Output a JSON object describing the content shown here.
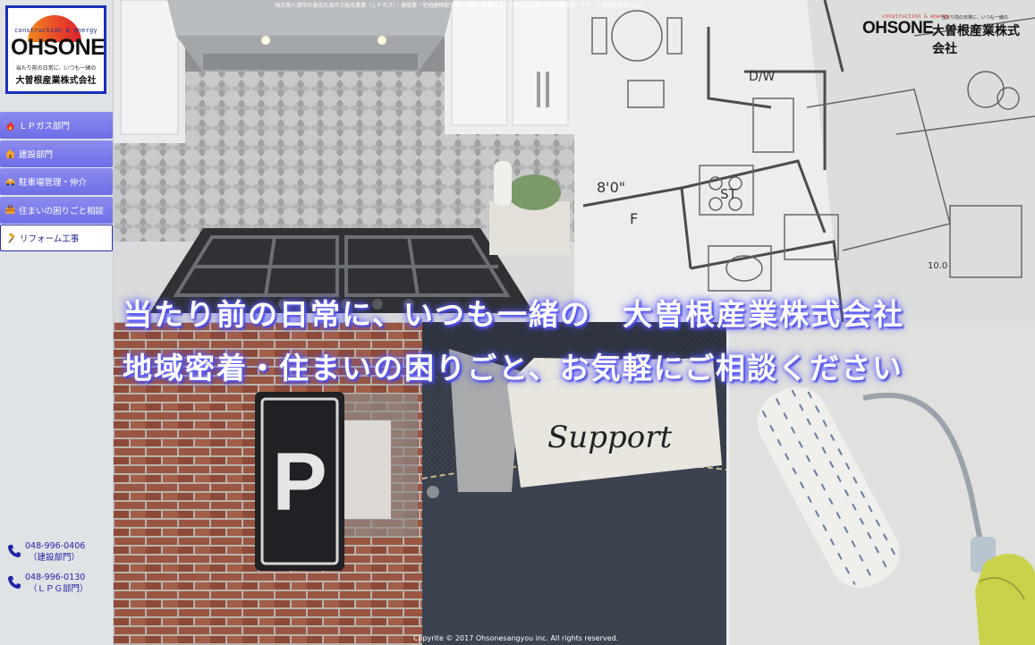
{
  "top_bar": {
    "text": "埼玉県八潮市の液化石油ガス販売事業（ＬＰガス）・建設業・宅地建物取引業・建築工事業所（リフォーム工事）・駐車場管理・仲介 | 大曽根産業株式会社"
  },
  "logo": {
    "tagline": "construction & energy",
    "brand": "OHSONE",
    "motto": "当たり前の日常に、いつも一緒の",
    "company": "大曽根産業株式会社"
  },
  "corner_logo": {
    "tagline": "construction & energy",
    "brand": "OHSONE",
    "motto": "当たり前の日常に、いつも一緒の",
    "company": "大曽根産業株式会社"
  },
  "menu": {
    "items": [
      {
        "label": "ＬＰガス部門",
        "icon": "flame-icon"
      },
      {
        "label": "建設部門",
        "icon": "house-icon"
      },
      {
        "label": "駐車場管理・仲介",
        "icon": "car-icon"
      },
      {
        "label": "住まいの困りごと相談",
        "icon": "tools-icon"
      },
      {
        "label": "リフォーム工事",
        "icon": "hammer-icon"
      }
    ],
    "active_index": 4
  },
  "contacts": [
    {
      "phone": "048-996-0406",
      "dept": "（建設部門）",
      "icon": "phone-icon"
    },
    {
      "phone": "048-996-0130",
      "dept": "（ＬＰＧ部門）",
      "icon": "phone-icon"
    }
  ],
  "headline": {
    "line1": "当たり前の日常に、いつも一緒の　大曽根産業株式会社",
    "line2": "地域密着・住まいの困りごと、お気軽にご相談ください"
  },
  "images": {
    "plan_labels": {
      "dw": "D/W",
      "dim": "8'0\"",
      "f": "F",
      "st": "ST",
      "side": "10.0"
    },
    "support_tag": "Support",
    "parking_sign": "P"
  },
  "copyright": "Copyrite © 2017 Ohsonesangyou inc. All rights reserved.",
  "colors": {
    "menu_bg": "#7a7aec",
    "active_border": "#2b2bb5",
    "logo_border": "#1830b8",
    "contact_text": "#2323a8",
    "headline_glow": "#5050ff"
  }
}
